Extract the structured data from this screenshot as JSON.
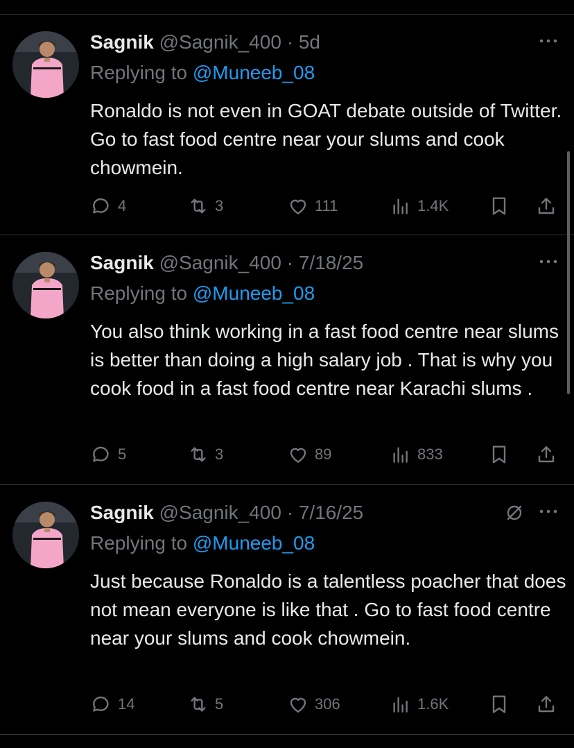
{
  "tweets": [
    {
      "name": "Sagnik",
      "handle": "@Sagnik_400",
      "sep": " · ",
      "time": "5d",
      "replying_prefix": "Replying to ",
      "replying_to": "@Muneeb_08",
      "text": "Ronaldo is not even in GOAT debate outside of Twitter. Go to fast food centre near your slums and cook chowmein.",
      "replies": "4",
      "reposts": "3",
      "likes": "111",
      "views": "1.4K",
      "muted": false
    },
    {
      "name": "Sagnik",
      "handle": "@Sagnik_400",
      "sep": " · ",
      "time": "7/18/25",
      "replying_prefix": "Replying to ",
      "replying_to": "@Muneeb_08",
      "text": "You also think working in a fast food centre near slums is better than doing a high salary job . That is why you cook food in a fast food centre near Karachi slums .",
      "replies": "5",
      "reposts": "3",
      "likes": "89",
      "views": "833",
      "muted": false
    },
    {
      "name": "Sagnik",
      "handle": "@Sagnik_400",
      "sep": " · ",
      "time": "7/16/25",
      "replying_prefix": "Replying to ",
      "replying_to": "@Muneeb_08",
      "text": "Just because Ronaldo is a talentless poacher that does not mean everyone is like that . Go to fast food centre near your slums and cook chowmein.",
      "replies": "14",
      "reposts": "5",
      "likes": "306",
      "views": "1.6K",
      "muted": true
    }
  ],
  "colors": {
    "background": "#000000",
    "text": "#e7e9ea",
    "muted_text": "#71767b",
    "link": "#1d9bf0",
    "divider": "#2f3336",
    "avatar_jersey": "#f4a6c8"
  },
  "icons": [
    "more-icon",
    "mute-icon",
    "reply-icon",
    "repost-icon",
    "like-icon",
    "views-icon",
    "bookmark-icon",
    "share-icon"
  ]
}
